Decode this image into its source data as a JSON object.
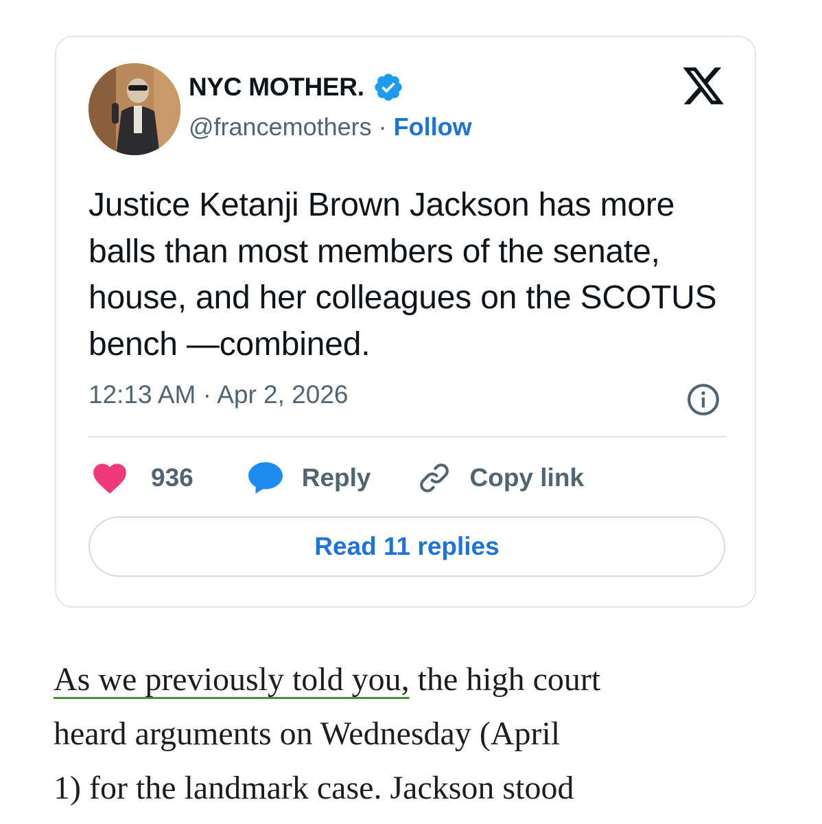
{
  "tweet": {
    "display_name": "NYC MOTHER.",
    "handle": "@francemothers",
    "separator": " · ",
    "follow_label": "Follow",
    "text": "Justice Ketanji Brown Jackson has more balls than most members of the senate, house, and her colleagues on the SCOTUS bench —combined.",
    "time": "12:13 AM",
    "date": "Apr 2, 2026",
    "likes": "936",
    "reply_label": "Reply",
    "copy_link_label": "Copy link",
    "read_replies_label": "Read 11 replies",
    "icons": {
      "verified": "verified-badge-icon",
      "platform": "x-logo-icon",
      "info": "info-icon",
      "like": "heart-icon",
      "reply": "speech-bubble-icon",
      "copy": "link-icon"
    },
    "colors": {
      "verified": "#1d9bf0",
      "link": "#1d73d8",
      "heart": "#f0397a"
    }
  },
  "article": {
    "link_text": "As we previously told you,",
    "line1_rest": " the high court",
    "line2": "heard arguments on Wednesday (April",
    "line3": "1) for the landmark case. Jackson stood"
  }
}
